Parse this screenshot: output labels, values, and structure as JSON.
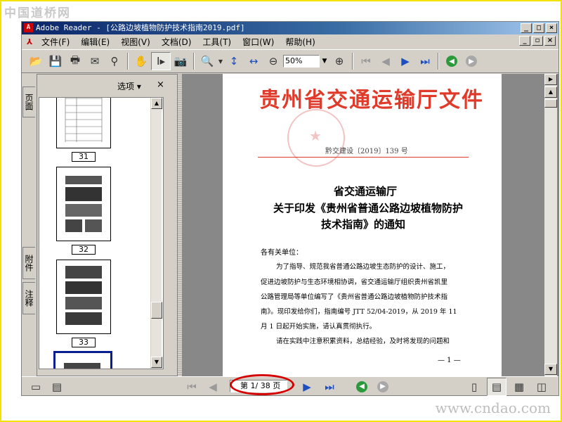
{
  "watermark": {
    "top": "中国道桥网",
    "bottom": "www.cndao.com"
  },
  "window": {
    "title": "Adobe Reader - [公路边坡植物防护技术指南2019.pdf]"
  },
  "menu": [
    "文件(F)",
    "编辑(E)",
    "视图(V)",
    "文档(D)",
    "工具(T)",
    "窗口(W)",
    "帮助(H)"
  ],
  "toolbar": {
    "zoom": "50%"
  },
  "left_tabs": [
    "页面",
    "附件",
    "注释"
  ],
  "nav_panel": {
    "options_label": "选项 ▾",
    "close": "×",
    "thumb_pages": [
      "31",
      "32",
      "33"
    ]
  },
  "document": {
    "header": "贵州省交通运输厅文件",
    "doc_number": "黔交建设〔2019〕139 号",
    "title_lines": [
      "省交通运输厅",
      "关于印发《贵州省普通公路边坡植物防护",
      "技术指南》的通知"
    ],
    "salutation": "各有关单位：",
    "body_lines": [
      "为了指导、规范我省普通公路边坡生态防护的设计、施工，",
      "促进边坡防护与生态环境相协调，省交通运输厅组织贵州省凯里",
      "公路管理局等单位编写了《贵州省普通公路边坡植物防护技术指",
      "南》。现印发给你们，指南编号 JTT 52/04-2019，从 2019 年 11",
      "月 1 日起开始实施，请认真贯彻执行。",
      "请在实践中注意积累资料，总结经验，及时将发现的问题和"
    ],
    "page_footer": "— 1 —"
  },
  "status": {
    "page_indicator": "第 1/ 38 页"
  },
  "colors": {
    "doc_red": "#e03a2a",
    "title_blue_start": "#0a246a",
    "highlight_oval": "#d40000"
  }
}
